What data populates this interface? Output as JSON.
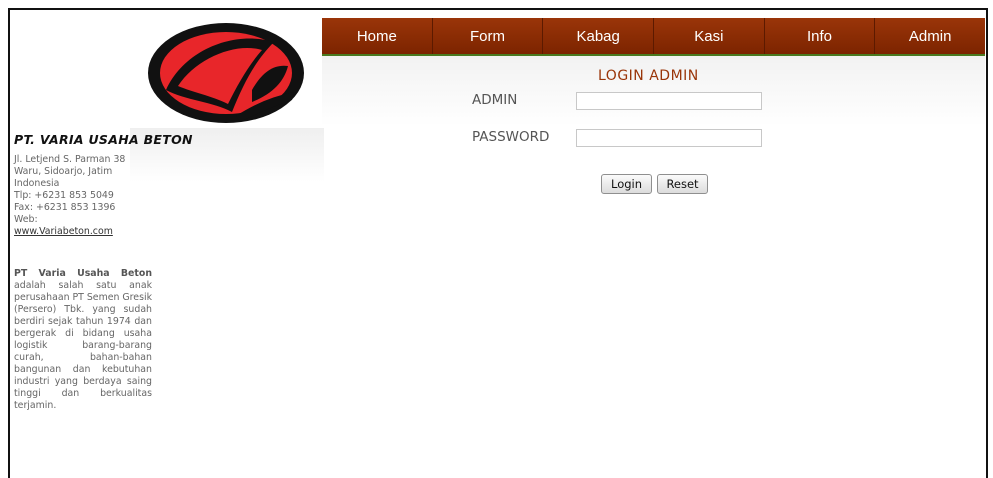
{
  "brand": {
    "company_name": "PT. VARIA USAHA BETON",
    "logo_icon": "varia-beton-logo-icon",
    "colors": {
      "logo_red": "#e8262a",
      "nav_brown": "#8a2d05",
      "title": "#9a3509"
    }
  },
  "sidebar": {
    "address_lines": [
      "Jl. Letjend S. Parman 38",
      "Waru, Sidoarjo, Jatim",
      "Indonesia",
      "Tlp: +6231 853 5049",
      "Fax: +6231 853 1396",
      "Web:"
    ],
    "website": "www.Variabeton.com",
    "about_bold": "PT Varia Usaha Beton",
    "about_text": "adalah salah satu anak perusahaan PT Semen Gresik (Persero) Tbk. yang sudah berdiri sejak tahun 1974 dan bergerak di bidang usaha logistik barang-barang curah, bahan-bahan bangunan dan kebutuhan industri yang berdaya saing tinggi dan berkualitas terjamin."
  },
  "nav": {
    "items": [
      "Home",
      "Form",
      "Kabag",
      "Kasi",
      "Info",
      "Admin"
    ]
  },
  "login": {
    "title": "LOGIN ADMIN",
    "admin_label": "ADMIN",
    "admin_value": "",
    "password_label": "PASSWORD",
    "password_value": "",
    "login_button": "Login",
    "reset_button": "Reset"
  }
}
